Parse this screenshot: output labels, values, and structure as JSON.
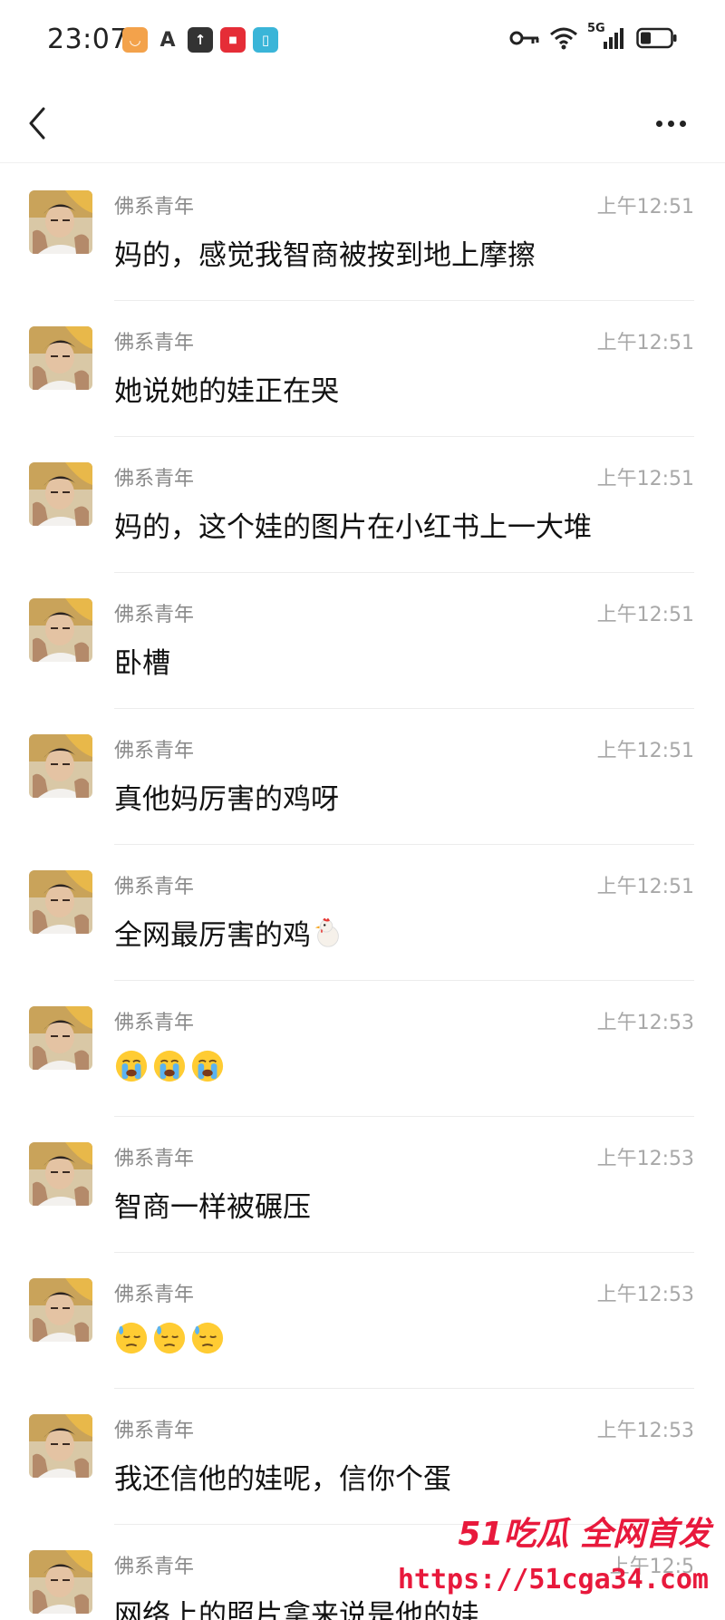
{
  "status_bar": {
    "time": "23:07",
    "network": "5G",
    "app_icons": [
      "bilibili-icon",
      "a-icon",
      "upload-icon",
      "news-icon",
      "book-icon"
    ]
  },
  "chat": {
    "messages": [
      {
        "sender": "佛系青年",
        "time": "上午12:51",
        "text": "妈的，感觉我智商被按到地上摩擦"
      },
      {
        "sender": "佛系青年",
        "time": "上午12:51",
        "text": "她说她的娃正在哭"
      },
      {
        "sender": "佛系青年",
        "time": "上午12:51",
        "text": "妈的，这个娃的图片在小红书上一大堆"
      },
      {
        "sender": "佛系青年",
        "time": "上午12:51",
        "text": "卧槽"
      },
      {
        "sender": "佛系青年",
        "time": "上午12:51",
        "text": "真他妈厉害的鸡呀"
      },
      {
        "sender": "佛系青年",
        "time": "上午12:51",
        "text": "全网最厉害的鸡",
        "emoji": "chicken"
      },
      {
        "sender": "佛系青年",
        "time": "上午12:53",
        "text": "",
        "emoji": "crying-face-x3"
      },
      {
        "sender": "佛系青年",
        "time": "上午12:53",
        "text": "智商一样被碾压"
      },
      {
        "sender": "佛系青年",
        "time": "上午12:53",
        "text": "",
        "emoji": "sweat-face-x3"
      },
      {
        "sender": "佛系青年",
        "time": "上午12:53",
        "text": "我还信他的娃呢，信你个蛋"
      },
      {
        "sender": "佛系青年",
        "time": "上午12:5",
        "text": "网络上的照片拿来说是他的娃"
      }
    ]
  },
  "watermark": {
    "line1": "51吃瓜 全网首发",
    "line2": "https://51cga34.com"
  },
  "colors": {
    "accent_red": "#e8193c",
    "sender_gray": "#8a8a8a",
    "time_gray": "#a8a8a8"
  }
}
